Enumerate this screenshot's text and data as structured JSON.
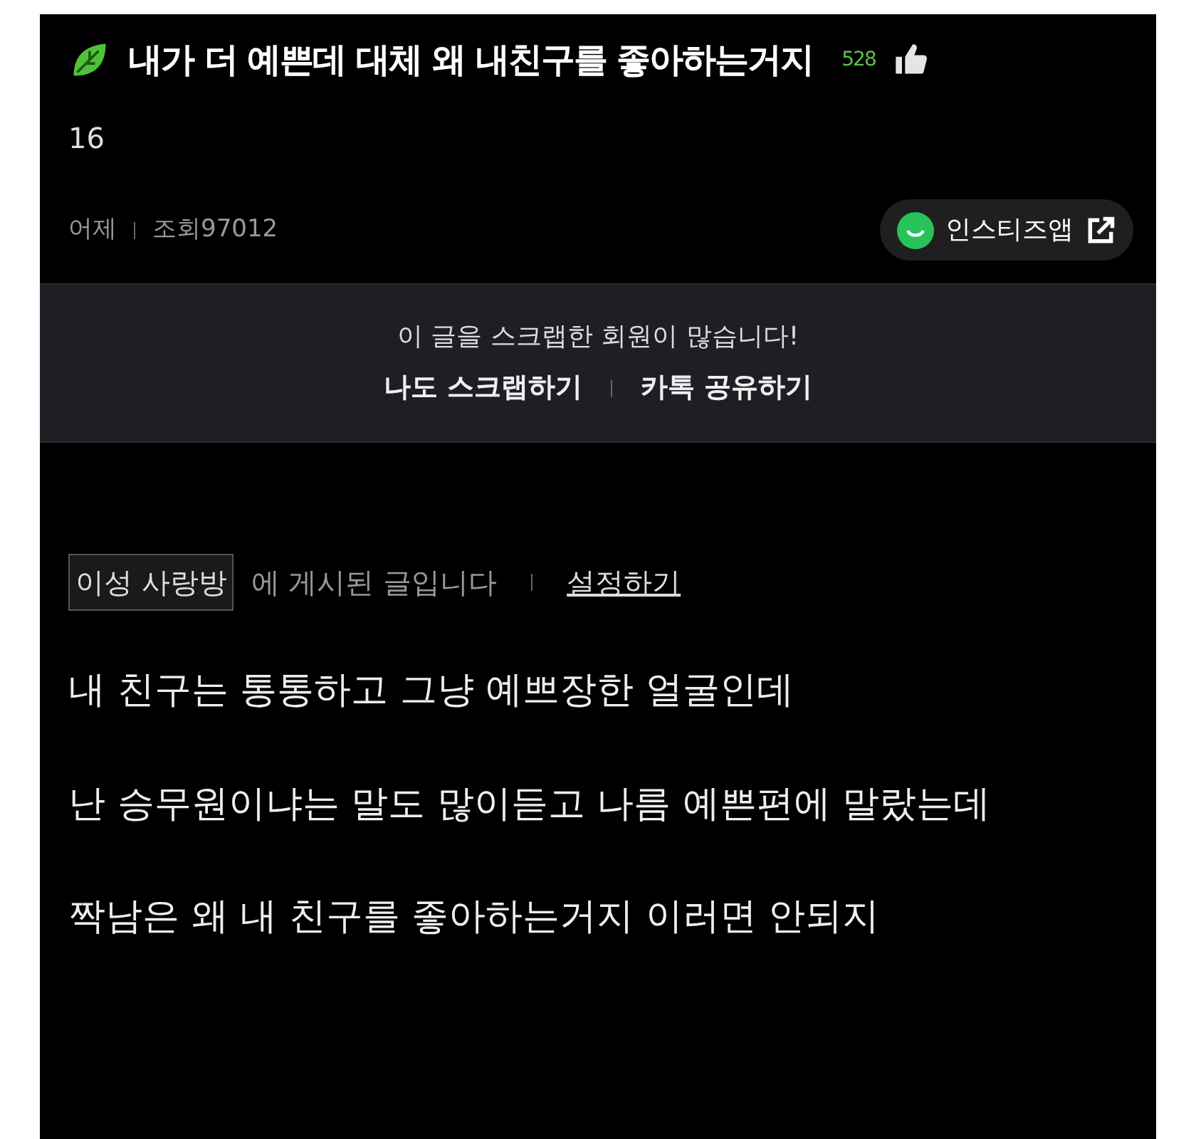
{
  "post": {
    "title": "내가 더 예쁜데 대체 왜 내친구를 좋아하는거지",
    "likes": "528",
    "comments": "16",
    "date": "어제",
    "views": "조회97012"
  },
  "app_button": {
    "label": "인스티즈앱"
  },
  "scrap_banner": {
    "message": "이 글을 스크랩한 회원이 많습니다!",
    "actions": [
      "나도 스크랩하기",
      "카톡 공유하기"
    ]
  },
  "board": {
    "name": "이성 사랑방",
    "suffix": "에 게시된 글입니다",
    "link": "설정하기"
  },
  "body": [
    "내 친구는 통통하고 그냥 예쁘장한 얼굴인데",
    "난 승무원이냐는 말도 많이듣고 나름 예쁜편에 말랐는데",
    "짝남은 왜 내 친구를 좋아하는거지 이러면 안되지"
  ]
}
